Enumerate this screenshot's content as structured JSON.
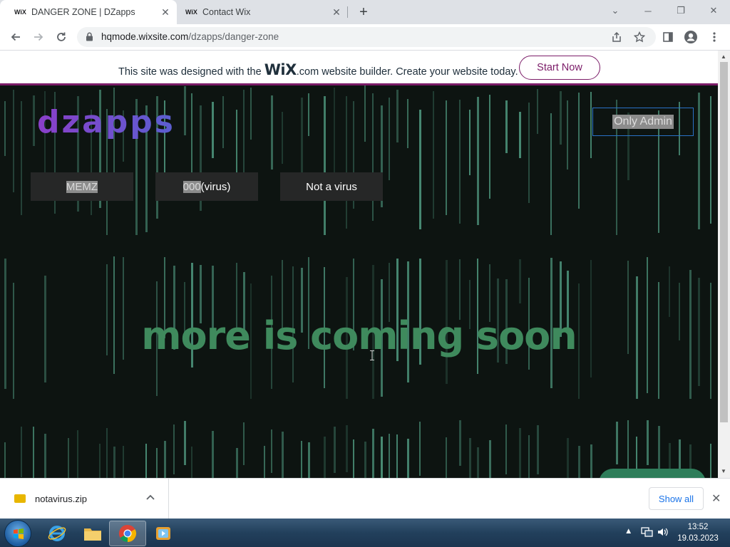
{
  "browser": {
    "tabs": [
      {
        "favicon": "WiX",
        "title": "DANGER ZONE | DZapps",
        "active": true
      },
      {
        "favicon": "WiX",
        "title": "Contact Wix",
        "active": false
      }
    ],
    "new_tab": "+",
    "window_controls": {
      "minimize": "─",
      "restore": "❐",
      "close": "✕",
      "tab_search": "⌄"
    },
    "url_host": "hqmode.wixsite.com",
    "url_path": "/dzapps/danger-zone"
  },
  "wix_banner": {
    "text_before": "This site was designed with the ",
    "logo": "WiX",
    "text_after": ".com website builder. Create your website today.",
    "button": "Start Now",
    "accent": "#7b1c68"
  },
  "site": {
    "brand": "dzapps",
    "admin_button": "Only Admin",
    "nav": [
      {
        "selected": "MEMZ",
        "rest": ""
      },
      {
        "selected": "000",
        "rest": " (virus)"
      },
      {
        "selected": "",
        "rest": "Not a virus"
      }
    ],
    "headline": "more is coming soon",
    "colors": {
      "background": "#0d1411",
      "headline": "#3f8a5d",
      "rain": "#6fd8b4"
    }
  },
  "downloads": {
    "file": "notavirus.zip",
    "show_all": "Show all",
    "close": "✕"
  },
  "taskbar": {
    "time": "13:52",
    "date": "19.03.2023",
    "apps": [
      "internet-explorer-icon",
      "file-explorer-icon",
      "chrome-icon",
      "media-player-icon"
    ]
  }
}
